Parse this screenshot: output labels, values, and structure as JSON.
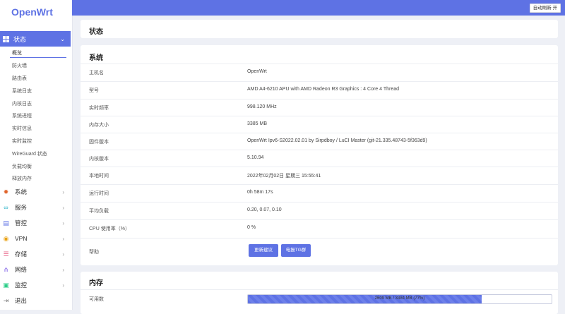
{
  "app": {
    "logo": "OpenWrt",
    "auto_refresh": "自动刷新 开"
  },
  "sidebar": {
    "active_menu": {
      "label": "状态"
    },
    "sub_items": [
      {
        "label": "概览"
      },
      {
        "label": "防火墙"
      },
      {
        "label": "路由表"
      },
      {
        "label": "系统日志"
      },
      {
        "label": "内核日志"
      },
      {
        "label": "系统进程"
      },
      {
        "label": "实时信息"
      },
      {
        "label": "实时监控"
      },
      {
        "label": "WireGuard 状态"
      },
      {
        "label": "负载均衡"
      },
      {
        "label": "释放内存"
      }
    ],
    "main_items": [
      {
        "label": "系统",
        "icon": "gear-icon",
        "color": "#e0652c"
      },
      {
        "label": "服务",
        "icon": "link-icon",
        "color": "#2bb3c8"
      },
      {
        "label": "管控",
        "icon": "control-icon",
        "color": "#5e72e4"
      },
      {
        "label": "VPN",
        "icon": "vpn-icon",
        "color": "#e9a215"
      },
      {
        "label": "存储",
        "icon": "storage-icon",
        "color": "#e96a8d"
      },
      {
        "label": "网络",
        "icon": "network-icon",
        "color": "#8a6de9"
      },
      {
        "label": "监控",
        "icon": "monitor-icon",
        "color": "#2dce89"
      },
      {
        "label": "退出",
        "icon": "logout-icon",
        "color": "#777777"
      }
    ]
  },
  "page": {
    "title": "状态"
  },
  "system": {
    "title": "系统",
    "rows": [
      {
        "key": "主机名",
        "value": "OpenWrt"
      },
      {
        "key": "型号",
        "value": "AMD A4-6210 APU with AMD Radeon R3 Graphics : 4 Core 4 Thread"
      },
      {
        "key": "实时频率",
        "value": "998.120 MHz"
      },
      {
        "key": "内存大小",
        "value": "3385 MB"
      },
      {
        "key": "固件版本",
        "value": "OpenWrt Ipv6-S2022.02.01 by Sirpdboy / LuCI Master (git-21.335.48743-5f363d9)"
      },
      {
        "key": "内核版本",
        "value": "5.10.94"
      },
      {
        "key": "本地时间",
        "value": "2022年02月02日 星期三 15:55:41"
      },
      {
        "key": "运行时间",
        "value": "0h 58m 17s"
      },
      {
        "key": "平均负载",
        "value": "0.20, 0.07, 0.10"
      },
      {
        "key": "CPU 使用率（%）",
        "value": "0 %"
      }
    ],
    "help": {
      "key": "帮助",
      "btn1": "更新建议",
      "btn2": "电报TG群"
    }
  },
  "memory": {
    "title": "内存",
    "available_label": "可用数",
    "progress_text": "2609 MB / 3384 MB (77%)",
    "progress_fraction": 0.77
  }
}
